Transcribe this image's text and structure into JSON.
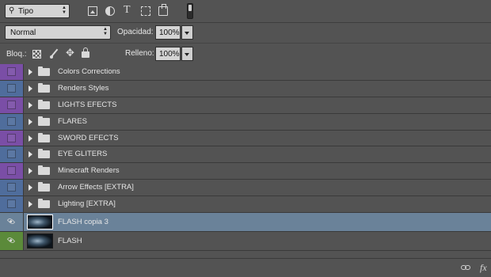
{
  "filter": {
    "label": "Tipo"
  },
  "blend_mode": {
    "value": "Normal"
  },
  "opacity": {
    "label": "Opacidad:",
    "value": "100%"
  },
  "lock": {
    "label": "Bloq.:"
  },
  "fill": {
    "label": "Relleno:",
    "value": "100%"
  },
  "colors": {
    "purple": "#7a4ea6",
    "blue": "#4f6d9c",
    "green": "#5b8a3a",
    "selected_row": "#6a8299"
  },
  "layers": [
    {
      "name": "Colors Corrections",
      "type": "group",
      "color": "purple"
    },
    {
      "name": "Renders Styles",
      "type": "group",
      "color": "blue"
    },
    {
      "name": "LIGHTS EFECTS",
      "type": "group",
      "color": "purple"
    },
    {
      "name": "FLARES",
      "type": "group",
      "color": "blue"
    },
    {
      "name": "SWORD EFECTS",
      "type": "group",
      "color": "purple"
    },
    {
      "name": "EYE GLITERS",
      "type": "group",
      "color": "blue"
    },
    {
      "name": "Minecraft Renders",
      "type": "group",
      "color": "purple"
    },
    {
      "name": "Arrow Effects [EXTRA]",
      "type": "group",
      "color": "blue"
    },
    {
      "name": "Lighting [EXTRA]",
      "type": "group",
      "color": "blue"
    },
    {
      "name": "FLASH copia 3",
      "type": "pixel",
      "color": "none",
      "selected": true,
      "visible": true
    },
    {
      "name": "FLASH",
      "type": "pixel",
      "color": "green",
      "visible": true
    }
  ],
  "icons": {
    "filter_pixel": "image-icon",
    "filter_adjust": "adjustment-icon",
    "filter_type": "type-icon",
    "filter_shape": "shape-icon",
    "filter_smart": "smart-object-icon",
    "footer_link": "link-icon",
    "footer_fx": "fx-icon"
  },
  "footer": {
    "fx": "fx"
  },
  "type_glyph": "T"
}
